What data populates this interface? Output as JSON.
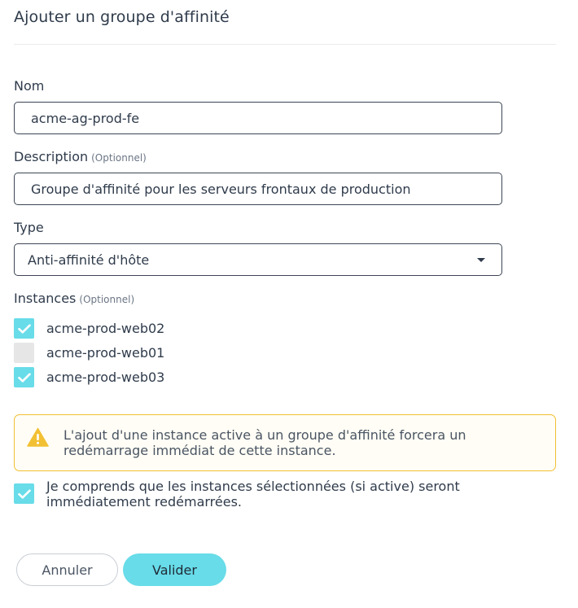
{
  "dialog": {
    "title": "Ajouter un groupe d'affinité"
  },
  "form": {
    "name": {
      "label": "Nom",
      "value": "acme-ag-prod-fe"
    },
    "description": {
      "label": "Description",
      "optional": "(Optionnel)",
      "value": "Groupe d'affinité pour les serveurs frontaux de production"
    },
    "type": {
      "label": "Type",
      "selected": "Anti-affinité d'hôte",
      "icon": "caret-down-icon"
    },
    "instances": {
      "label": "Instances",
      "optional": "(Optionnel)",
      "items": [
        {
          "label": "acme-prod-web02",
          "checked": true
        },
        {
          "label": "acme-prod-web01",
          "checked": false
        },
        {
          "label": "acme-prod-web03",
          "checked": true
        }
      ]
    }
  },
  "warning": {
    "icon": "warning-icon",
    "text": "L'ajout d'une instance active à un groupe d'affinité forcera un redémarrage immédiat de cette instance."
  },
  "acknowledge": {
    "label": "Je comprends que les instances sélectionnées (si active) seront immédiatement redémarrées.",
    "checked": true
  },
  "buttons": {
    "cancel": "Annuler",
    "submit": "Valider"
  },
  "colors": {
    "accent": "#68dce8",
    "warning_border": "#f2c033",
    "warning_icon": "#f2c033",
    "text": "#2f3b4b"
  }
}
